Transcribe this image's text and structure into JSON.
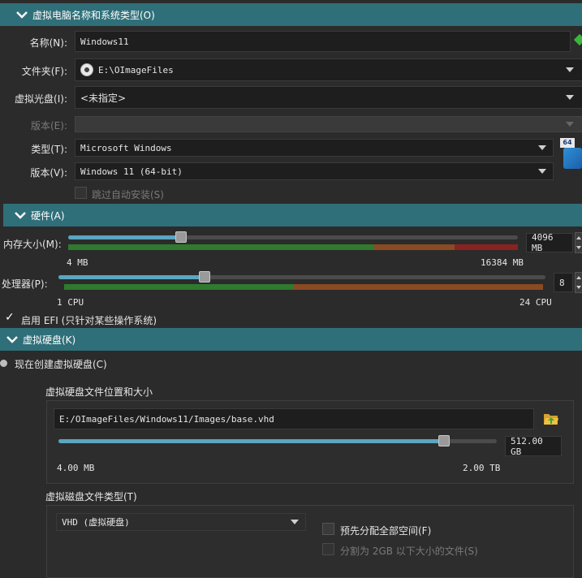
{
  "name_os": {
    "header": "虚拟电脑名称和系统类型(O)",
    "name_label": "名称(N):",
    "name_value": "Windows11",
    "folder_label": "文件夹(F):",
    "folder_value": "E:\\OImageFiles",
    "iso_label": "虚拟光盘(I):",
    "iso_value": "<未指定>",
    "edition_label": "版本(E):",
    "edition_value": "",
    "type_label": "类型(T):",
    "type_value": "Microsoft Windows",
    "version_label": "版本(V):",
    "version_value": "Windows 11 (64-bit)",
    "skip_unattended_label": "跳过自动安装(S)",
    "os_badge_text": "64"
  },
  "hardware": {
    "header": "硬件(A)",
    "memory_label": "内存大小(M):",
    "memory_value": "4096 MB",
    "memory_min": "4 MB",
    "memory_max": "16384 MB",
    "memory_fraction": 0.25,
    "cpu_label": "处理器(P):",
    "cpu_value": "8",
    "cpu_min": "1 CPU",
    "cpu_max": "24 CPU",
    "cpu_fraction": 0.3,
    "efi_label": "启用 EFI (只针对某些操作系统)",
    "efi_checked": "✓"
  },
  "disk": {
    "header": "虚拟硬盘(K)",
    "create_label": "现在创建虚拟硬盘(C)",
    "location_title": "虚拟硬盘文件位置和大小",
    "location_value": "E:/OImageFiles/Windows11/Images/base.vhd",
    "size_value": "512.00 GB",
    "size_min": "4.00 MB",
    "size_max": "2.00 TB",
    "size_fraction": 0.88,
    "type_title": "虚拟磁盘文件类型(T)",
    "type_value": "VHD (虚拟硬盘)",
    "preallocate_label": "预先分配全部空间(F)",
    "split_label": "分割为 2GB 以下大小的文件(S)"
  },
  "colors": {
    "section_bg": "#2f6f79",
    "accent": "#5aa5c0",
    "range_green": "#2f7a2f",
    "range_orange": "#8a4a22",
    "range_red": "#8a2222"
  },
  "icons": [
    "chevron-down-icon",
    "disc-icon",
    "accept-icon",
    "folder-open-icon",
    "os-windows-icon"
  ]
}
